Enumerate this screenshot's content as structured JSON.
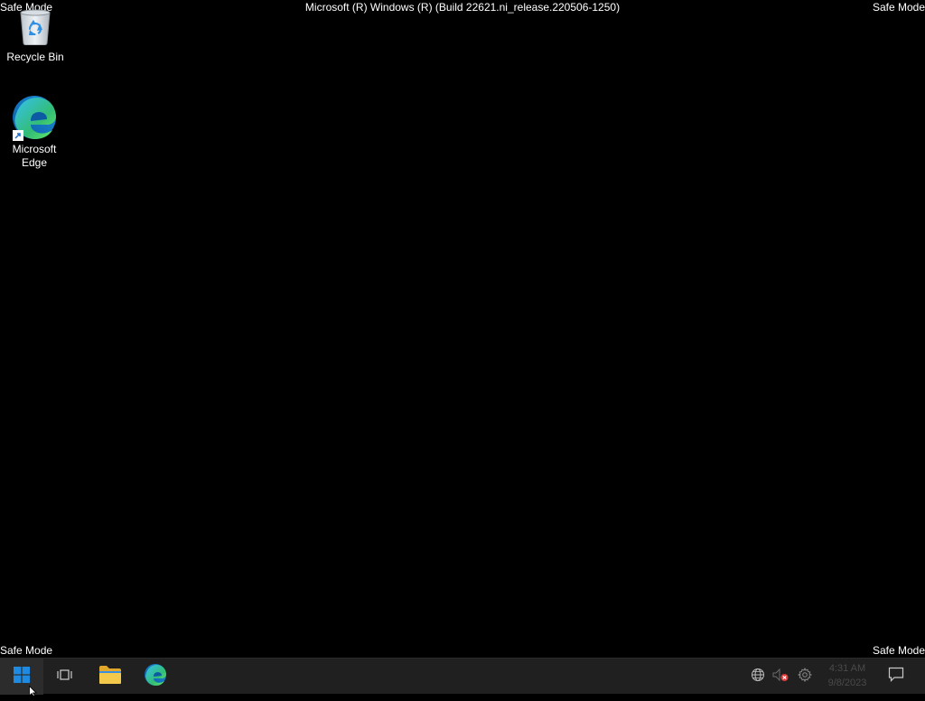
{
  "desktop": {
    "safe_mode_label": "Safe Mode",
    "build_string": "Microsoft (R) Windows (R) (Build 22621.ni_release.220506-1250)",
    "background_color": "#000000",
    "icons": [
      {
        "label": "Recycle Bin",
        "icon": "recycle-bin-icon"
      },
      {
        "label": "Microsoft Edge",
        "icon": "edge-icon",
        "shortcut": true
      }
    ]
  },
  "taskbar": {
    "background_color": "#202020",
    "pinned": [
      {
        "name": "Start",
        "icon": "windows-start-icon",
        "accent": "#1f8ae2"
      },
      {
        "name": "Task View",
        "icon": "task-view-icon"
      },
      {
        "name": "File Explorer",
        "icon": "folder-icon",
        "accent": "#f0c33a"
      },
      {
        "name": "Microsoft Edge",
        "icon": "edge-icon"
      }
    ],
    "tray": {
      "network_icon": "globe-network-icon",
      "volume_icon": "speaker-muted-icon",
      "settings_icon": "gear-icon",
      "time": "4:31 AM",
      "date": "9/8/2023",
      "notifications_icon": "notification-bubble-icon"
    }
  }
}
